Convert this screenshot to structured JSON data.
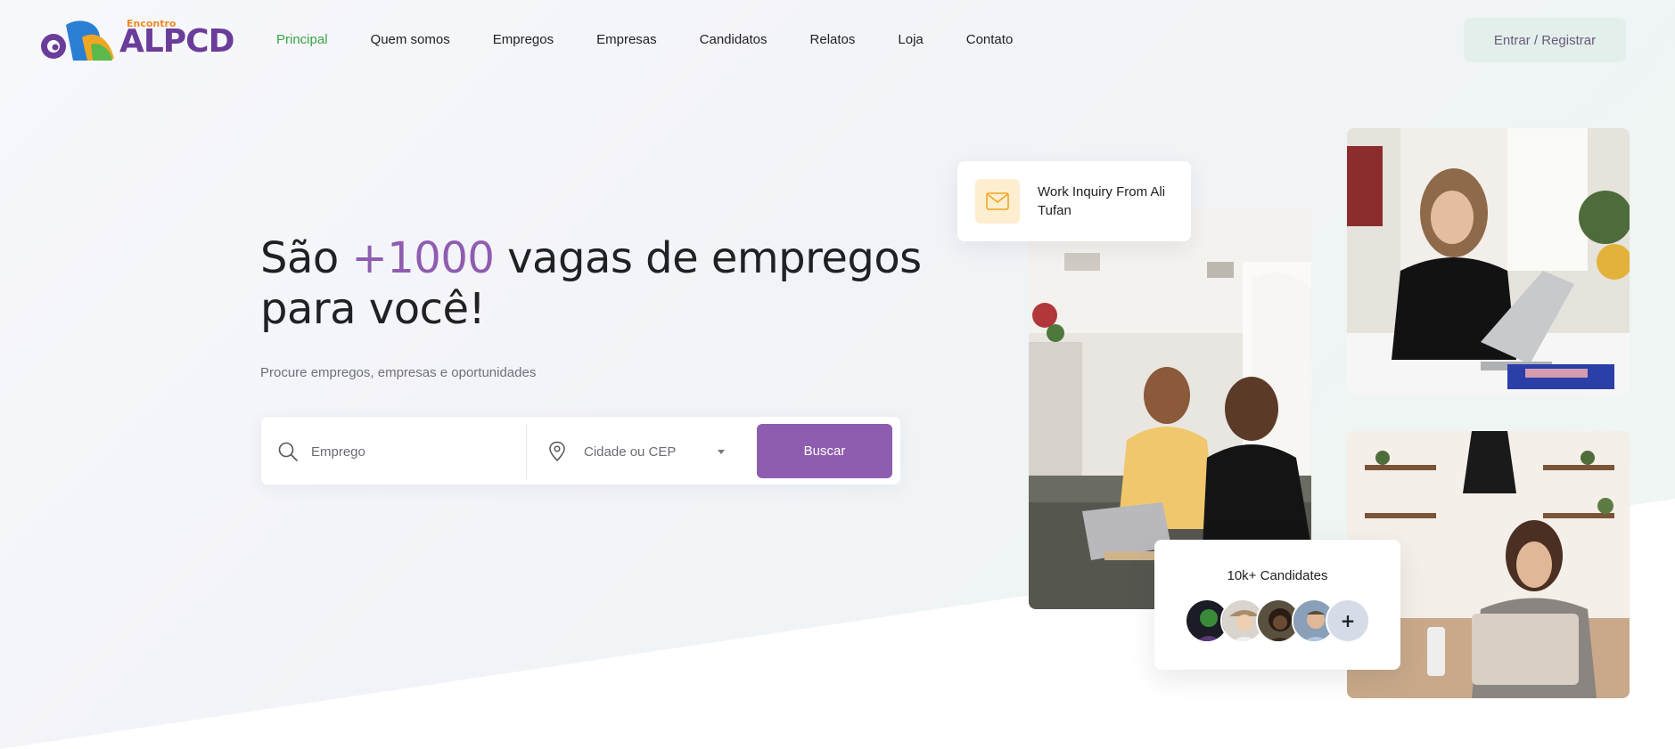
{
  "header": {
    "logo_small": "Encontro",
    "logo_main": "ALPCD",
    "nav": [
      {
        "label": "Principal",
        "active": true
      },
      {
        "label": "Quem somos",
        "active": false
      },
      {
        "label": "Empregos",
        "active": false
      },
      {
        "label": "Empresas",
        "active": false
      },
      {
        "label": "Candidatos",
        "active": false
      },
      {
        "label": "Relatos",
        "active": false
      },
      {
        "label": "Loja",
        "active": false
      },
      {
        "label": "Contato",
        "active": false
      }
    ],
    "login_label": "Entrar / Registrar"
  },
  "hero": {
    "title_pre": "São ",
    "title_accent": "+1000",
    "title_post": " vagas de empregos para você!",
    "subtitle": "Procure empregos, empresas e oportunidades"
  },
  "search": {
    "job_placeholder": "Emprego",
    "city_placeholder": "Cidade ou CEP",
    "button_label": "Buscar"
  },
  "cards": {
    "inquiry_text": "Work Inquiry From Ali Tufan",
    "candidates_title": "10k+ Candidates",
    "plus_label": "+"
  },
  "colors": {
    "accent_purple": "#8f5db0",
    "active_green": "#3aa346",
    "login_bg": "#e3efeb",
    "mail_badge_bg": "#feeed0"
  }
}
